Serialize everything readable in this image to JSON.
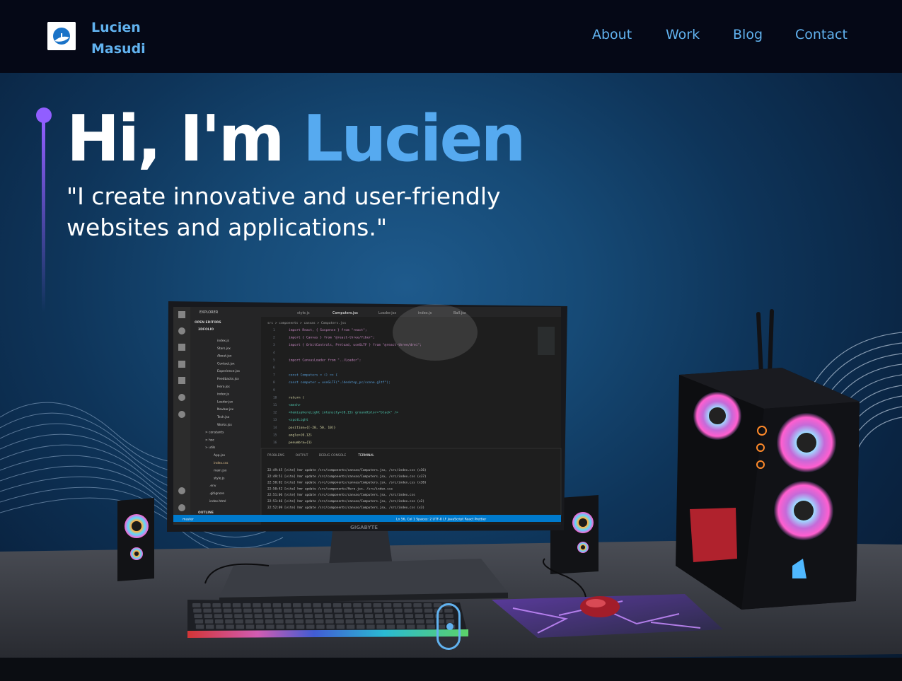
{
  "nav": {
    "brand_first": "Lucien",
    "brand_last": "Masudi",
    "links": [
      {
        "label": "About"
      },
      {
        "label": "Work"
      },
      {
        "label": "Blog"
      },
      {
        "label": "Contact"
      }
    ]
  },
  "hero": {
    "greeting": "Hi, I'm",
    "name": "Lucien",
    "subtitle": "\"I create innovative and user-friendly websites and applications.\""
  },
  "monitor": {
    "brand": "GIGABYTE",
    "explorer_header": "EXPLORER",
    "open_editors": "OPEN EDITORS",
    "folder": "3DFOLIO",
    "files": [
      "index.js",
      "Stars.jsx",
      "About.jsx",
      "Contact.jsx",
      "Experience.jsx",
      "Feedbacks.jsx",
      "Hero.jsx",
      "index.js",
      "Loader.jsx",
      "Navbar.jsx",
      "Tech.jsx",
      "Works.jsx"
    ],
    "folders": [
      "constants",
      "hoc",
      "utils"
    ],
    "root_files": [
      "App.jsx",
      "index.css",
      "main.jsx",
      "style.js"
    ],
    "extra_files": [
      ".env",
      ".gitignore",
      "index.html"
    ],
    "outline": "OUTLINE",
    "tabs": [
      "style.js",
      "Computers.jsx",
      "Loader.jsx",
      "index.js",
      "Ball.jsx"
    ],
    "breadcrumb": "src > components > canvas > Computers.jsx",
    "code_lines": [
      "import React, { Suspense } from \"react\";",
      "import { Canvas } from \"@react-three/fiber\";",
      "import { OrbitControls, Preload, useGLTF } from \"@react-three/drei\";",
      "",
      "import CanvasLoader from \"../Loader\";",
      "",
      "const Computers = () => {",
      "  const computer = useGLTF(\"./desktop_pc/scene.gltf\");",
      "",
      "  return (",
      "    <mesh>",
      "      <hemisphereLight intensity={0.15} groundColor=\"black\" />",
      "      <spotLight",
      "        position={[-20, 50, 10]}",
      "        angle={0.12}",
      "        penumbra={1}"
    ],
    "panel_tabs": [
      "PROBLEMS",
      "OUTPUT",
      "DEBUG CONSOLE",
      "TERMINAL"
    ],
    "terminal_lines": [
      "22:49:45 [vite] hmr update /src/components/canvas/Computers.jsx, /src/index.css (x36)",
      "22:49:51 [vite] hmr update /src/components/canvas/Computers.jsx, /src/index.css (x37)",
      "22:50:02 [vite] hmr update /src/components/canvas/Computers.jsx, /src/index.css (x38)",
      "22:50:42 [vite] hmr update /src/components/Hero.jsx, /src/index.css",
      "22:51:06 [vite] hmr update /src/components/canvas/Computers.jsx, /src/index.css",
      "22:51:46 [vite] hmr update /src/components/canvas/Computers.jsx, /src/index.css (x2)",
      "22:52:09 [vite] hmr update /src/components/canvas/Computers.jsx, /src/index.css (x3)"
    ],
    "status_left": "master",
    "status_right": "Ln 56, Col 1   Spaces: 2   UTF-8   LF   JavaScript React   Prettier"
  }
}
